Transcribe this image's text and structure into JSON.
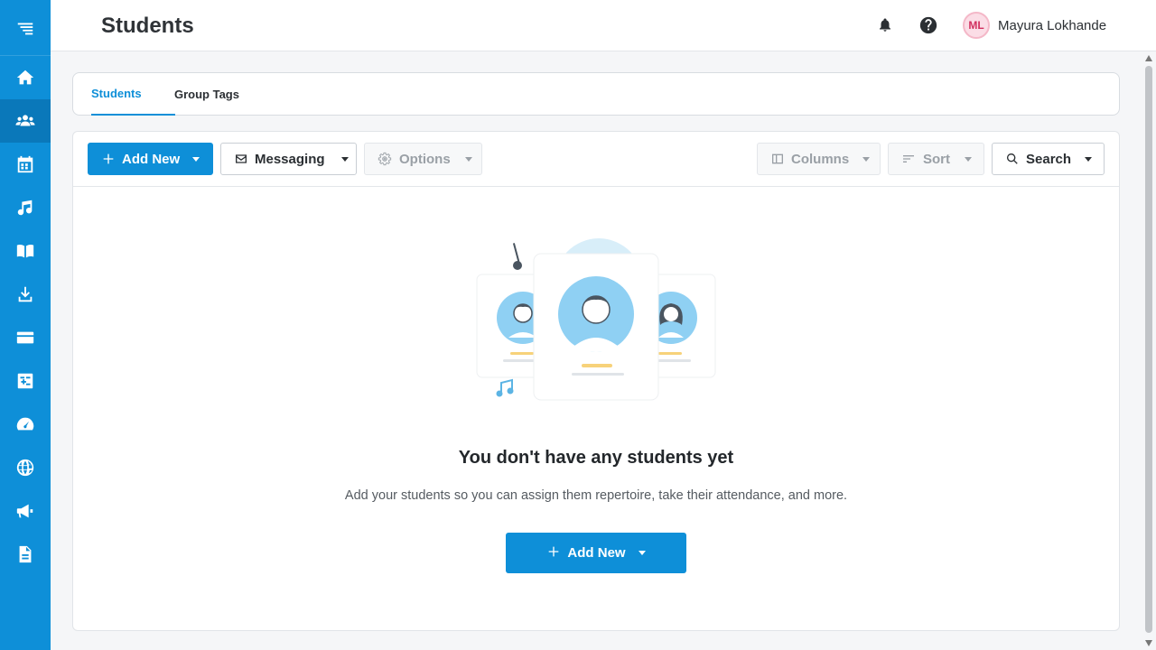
{
  "app": {
    "page_title": "Students"
  },
  "sidebar": {
    "items": [
      {
        "icon": "home-icon"
      },
      {
        "icon": "students-icon",
        "active": true
      },
      {
        "icon": "calendar-icon"
      },
      {
        "icon": "music-note-icon"
      },
      {
        "icon": "book-icon"
      },
      {
        "icon": "download-icon"
      },
      {
        "icon": "credit-card-icon"
      },
      {
        "icon": "calculator-icon"
      },
      {
        "icon": "dashboard-icon"
      },
      {
        "icon": "globe-icon"
      },
      {
        "icon": "megaphone-icon"
      },
      {
        "icon": "document-icon"
      }
    ]
  },
  "header": {
    "user_initials": "ML",
    "user_name": "Mayura Lokhande"
  },
  "tabs": [
    {
      "label": "Students",
      "active": true
    },
    {
      "label": "Group Tags",
      "active": false
    }
  ],
  "toolbar": {
    "add_new": "Add New",
    "messaging": "Messaging",
    "options": "Options",
    "columns": "Columns",
    "sort": "Sort",
    "search": "Search"
  },
  "empty_state": {
    "title": "You don't have any students yet",
    "description": "Add your students so you can assign them repertoire, take their attendance, and more.",
    "cta_label": "Add New"
  },
  "colors": {
    "brand": "#0e8fd8",
    "sidebar_active": "#0a78ba",
    "avatar_bg": "#fbdde6",
    "avatar_text": "#d1305f"
  }
}
